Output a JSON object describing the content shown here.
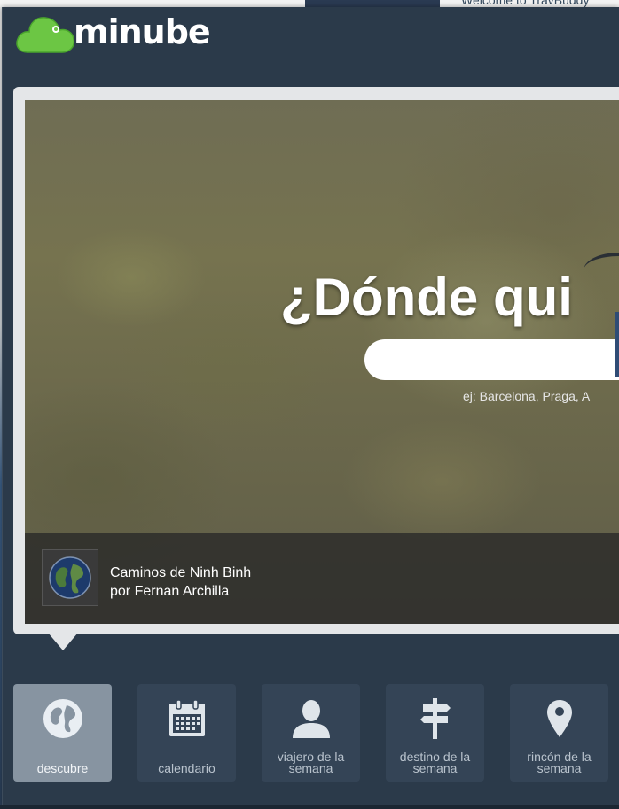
{
  "background_page": {
    "top_text": "Welcome to TravBuddy"
  },
  "header": {
    "logo_text": "minube",
    "logo_icon": "green-cloud-icon",
    "logo_color": "#6cc644"
  },
  "hero": {
    "headline": "¿Dónde qui",
    "search": {
      "value": "",
      "placeholder": ""
    },
    "hint": "ej: Barcelona, Praga, A",
    "caption": {
      "title": "Caminos de Ninh Binh",
      "author": "por Fernan Archilla",
      "thumb_icon": "earth-globe-icon"
    }
  },
  "nav": {
    "items": [
      {
        "label": "descubre",
        "icon": "globe-icon",
        "active": true
      },
      {
        "label": "calendario",
        "icon": "calendar-icon",
        "active": false
      },
      {
        "label": "viajero de la semana",
        "icon": "person-icon",
        "active": false
      },
      {
        "label": "destino de la semana",
        "icon": "signpost-icon",
        "active": false
      },
      {
        "label": "rincón de la semana",
        "icon": "map-pin-icon",
        "active": false
      }
    ]
  },
  "colors": {
    "panel_bg": "#2b3a4a",
    "nav_item_bg": "#344456",
    "nav_item_active_bg": "#8794a1",
    "hero_frame": "#e4e6e8"
  }
}
